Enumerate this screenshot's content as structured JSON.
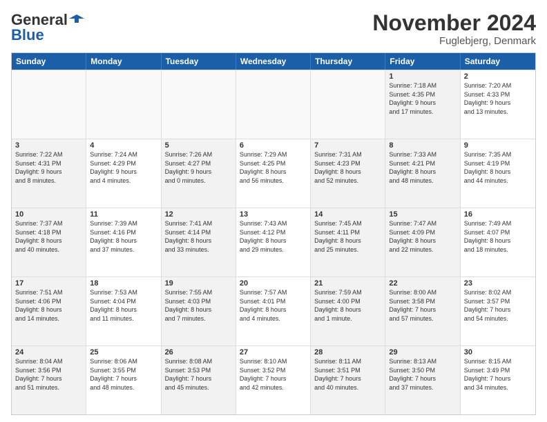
{
  "logo": {
    "general": "General",
    "blue": "Blue"
  },
  "header": {
    "month": "November 2024",
    "location": "Fuglebjerg, Denmark"
  },
  "weekdays": [
    "Sunday",
    "Monday",
    "Tuesday",
    "Wednesday",
    "Thursday",
    "Friday",
    "Saturday"
  ],
  "weeks": [
    [
      {
        "day": "",
        "text": "",
        "empty": true
      },
      {
        "day": "",
        "text": "",
        "empty": true
      },
      {
        "day": "",
        "text": "",
        "empty": true
      },
      {
        "day": "",
        "text": "",
        "empty": true
      },
      {
        "day": "",
        "text": "",
        "empty": true
      },
      {
        "day": "1",
        "text": "Sunrise: 7:18 AM\nSunset: 4:35 PM\nDaylight: 9 hours\nand 17 minutes.",
        "shaded": true
      },
      {
        "day": "2",
        "text": "Sunrise: 7:20 AM\nSunset: 4:33 PM\nDaylight: 9 hours\nand 13 minutes.",
        "shaded": false
      }
    ],
    [
      {
        "day": "3",
        "text": "Sunrise: 7:22 AM\nSunset: 4:31 PM\nDaylight: 9 hours\nand 8 minutes.",
        "shaded": true
      },
      {
        "day": "4",
        "text": "Sunrise: 7:24 AM\nSunset: 4:29 PM\nDaylight: 9 hours\nand 4 minutes.",
        "shaded": false
      },
      {
        "day": "5",
        "text": "Sunrise: 7:26 AM\nSunset: 4:27 PM\nDaylight: 9 hours\nand 0 minutes.",
        "shaded": true
      },
      {
        "day": "6",
        "text": "Sunrise: 7:29 AM\nSunset: 4:25 PM\nDaylight: 8 hours\nand 56 minutes.",
        "shaded": false
      },
      {
        "day": "7",
        "text": "Sunrise: 7:31 AM\nSunset: 4:23 PM\nDaylight: 8 hours\nand 52 minutes.",
        "shaded": true
      },
      {
        "day": "8",
        "text": "Sunrise: 7:33 AM\nSunset: 4:21 PM\nDaylight: 8 hours\nand 48 minutes.",
        "shaded": true
      },
      {
        "day": "9",
        "text": "Sunrise: 7:35 AM\nSunset: 4:19 PM\nDaylight: 8 hours\nand 44 minutes.",
        "shaded": false
      }
    ],
    [
      {
        "day": "10",
        "text": "Sunrise: 7:37 AM\nSunset: 4:18 PM\nDaylight: 8 hours\nand 40 minutes.",
        "shaded": true
      },
      {
        "day": "11",
        "text": "Sunrise: 7:39 AM\nSunset: 4:16 PM\nDaylight: 8 hours\nand 37 minutes.",
        "shaded": false
      },
      {
        "day": "12",
        "text": "Sunrise: 7:41 AM\nSunset: 4:14 PM\nDaylight: 8 hours\nand 33 minutes.",
        "shaded": true
      },
      {
        "day": "13",
        "text": "Sunrise: 7:43 AM\nSunset: 4:12 PM\nDaylight: 8 hours\nand 29 minutes.",
        "shaded": false
      },
      {
        "day": "14",
        "text": "Sunrise: 7:45 AM\nSunset: 4:11 PM\nDaylight: 8 hours\nand 25 minutes.",
        "shaded": true
      },
      {
        "day": "15",
        "text": "Sunrise: 7:47 AM\nSunset: 4:09 PM\nDaylight: 8 hours\nand 22 minutes.",
        "shaded": true
      },
      {
        "day": "16",
        "text": "Sunrise: 7:49 AM\nSunset: 4:07 PM\nDaylight: 8 hours\nand 18 minutes.",
        "shaded": false
      }
    ],
    [
      {
        "day": "17",
        "text": "Sunrise: 7:51 AM\nSunset: 4:06 PM\nDaylight: 8 hours\nand 14 minutes.",
        "shaded": true
      },
      {
        "day": "18",
        "text": "Sunrise: 7:53 AM\nSunset: 4:04 PM\nDaylight: 8 hours\nand 11 minutes.",
        "shaded": false
      },
      {
        "day": "19",
        "text": "Sunrise: 7:55 AM\nSunset: 4:03 PM\nDaylight: 8 hours\nand 7 minutes.",
        "shaded": true
      },
      {
        "day": "20",
        "text": "Sunrise: 7:57 AM\nSunset: 4:01 PM\nDaylight: 8 hours\nand 4 minutes.",
        "shaded": false
      },
      {
        "day": "21",
        "text": "Sunrise: 7:59 AM\nSunset: 4:00 PM\nDaylight: 8 hours\nand 1 minute.",
        "shaded": true
      },
      {
        "day": "22",
        "text": "Sunrise: 8:00 AM\nSunset: 3:58 PM\nDaylight: 7 hours\nand 57 minutes.",
        "shaded": true
      },
      {
        "day": "23",
        "text": "Sunrise: 8:02 AM\nSunset: 3:57 PM\nDaylight: 7 hours\nand 54 minutes.",
        "shaded": false
      }
    ],
    [
      {
        "day": "24",
        "text": "Sunrise: 8:04 AM\nSunset: 3:56 PM\nDaylight: 7 hours\nand 51 minutes.",
        "shaded": true
      },
      {
        "day": "25",
        "text": "Sunrise: 8:06 AM\nSunset: 3:55 PM\nDaylight: 7 hours\nand 48 minutes.",
        "shaded": false
      },
      {
        "day": "26",
        "text": "Sunrise: 8:08 AM\nSunset: 3:53 PM\nDaylight: 7 hours\nand 45 minutes.",
        "shaded": true
      },
      {
        "day": "27",
        "text": "Sunrise: 8:10 AM\nSunset: 3:52 PM\nDaylight: 7 hours\nand 42 minutes.",
        "shaded": false
      },
      {
        "day": "28",
        "text": "Sunrise: 8:11 AM\nSunset: 3:51 PM\nDaylight: 7 hours\nand 40 minutes.",
        "shaded": true
      },
      {
        "day": "29",
        "text": "Sunrise: 8:13 AM\nSunset: 3:50 PM\nDaylight: 7 hours\nand 37 minutes.",
        "shaded": true
      },
      {
        "day": "30",
        "text": "Sunrise: 8:15 AM\nSunset: 3:49 PM\nDaylight: 7 hours\nand 34 minutes.",
        "shaded": false
      }
    ]
  ]
}
